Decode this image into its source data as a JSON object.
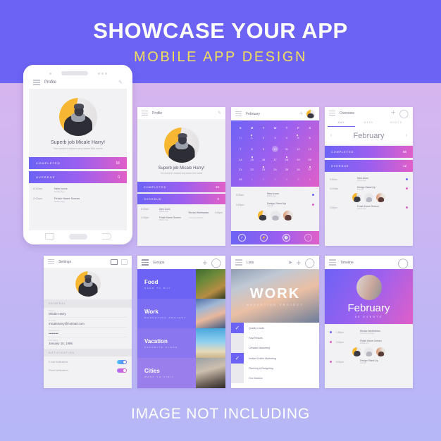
{
  "header": {
    "title": "SHOWCASE YOUR APP",
    "subtitle": "MOBILE APP DESIGN"
  },
  "footer": {
    "note": "IMAGE NOT INCLUDING"
  },
  "colors": {
    "brand_purple": "#6c63f5",
    "accent_yellow": "#f3e05a",
    "gradient_start": "#6c63f5",
    "gradient_mid": "#9a5ff0",
    "gradient_end": "#e05fc8",
    "bg_top": "#dcb3ec",
    "bg_bottom": "#b5b7f7",
    "screen_bg": "#f2f2f4"
  },
  "profile_screen": {
    "appbar": {
      "title": "Profile",
      "edit_icon": "pencil-icon",
      "menu_icon": "hamburger-icon"
    },
    "greeting": "Superb job Micale Harry!",
    "greeting_sub": "You haven't missed any tasks this week",
    "stats": [
      {
        "label": "COMPLETED",
        "value": "16"
      },
      {
        "label": "OVERDUE",
        "value": "0"
      }
    ],
    "tasks": [
      {
        "time": "8:30am",
        "name": "New Icons",
        "sub": "Mobile App"
      },
      {
        "time": "2:00pm",
        "name": "Finish Home Screen",
        "sub": "Mobile App"
      },
      {
        "time": "2:00pm",
        "name": "Revise Wireframes",
        "sub": "Company Website"
      }
    ]
  },
  "calendar_screen": {
    "appbar": {
      "title": "February",
      "dropdown_icon": "chevron-down-icon",
      "add_icon": "plus-icon",
      "avatar": "user-avatar"
    },
    "weekdays": [
      "S",
      "M",
      "T",
      "W",
      "T",
      "F",
      "S"
    ],
    "weeks": [
      [
        {
          "d": "31",
          "dim": true
        },
        {
          "d": "1",
          "mark": true
        },
        {
          "d": "2"
        },
        {
          "d": "3"
        },
        {
          "d": "4"
        },
        {
          "d": "5",
          "mark": true
        },
        {
          "d": "6"
        }
      ],
      [
        {
          "d": "7"
        },
        {
          "d": "8"
        },
        {
          "d": "9"
        },
        {
          "d": "10",
          "today": true
        },
        {
          "d": "11"
        },
        {
          "d": "12"
        },
        {
          "d": "13"
        }
      ],
      [
        {
          "d": "14"
        },
        {
          "d": "15",
          "mark": true
        },
        {
          "d": "16"
        },
        {
          "d": "17"
        },
        {
          "d": "18",
          "mark": true
        },
        {
          "d": "19"
        },
        {
          "d": "20"
        }
      ],
      [
        {
          "d": "21"
        },
        {
          "d": "22"
        },
        {
          "d": "23",
          "mark": true
        },
        {
          "d": "24"
        },
        {
          "d": "25"
        },
        {
          "d": "26"
        },
        {
          "d": "27",
          "mark": true
        }
      ],
      [
        {
          "d": "28"
        },
        {
          "d": "1",
          "dim": true
        },
        {
          "d": "2",
          "dim": true
        },
        {
          "d": "3",
          "dim": true
        },
        {
          "d": "4",
          "dim": true
        },
        {
          "d": "5",
          "dim": true
        },
        {
          "d": "6",
          "dim": true
        }
      ]
    ],
    "agenda": [
      {
        "time": "8:30am",
        "name": "New Icons",
        "sub": "Mobile App",
        "dot": "#6c63f5"
      },
      {
        "time": "5:00pm",
        "name": "Design Stand Up",
        "sub": "Internal",
        "dot": "#e05fc8"
      }
    ],
    "nav_icons": [
      "check-circle-icon",
      "flash-circle-icon",
      "clock-circle-icon",
      "info-circle-icon"
    ]
  },
  "overview_screen": {
    "appbar": {
      "title": "Overview",
      "add_icon": "plus-icon",
      "search_icon": "search-icon"
    },
    "tabs": [
      {
        "label": "DAY",
        "active": true
      },
      {
        "label": "WEEK",
        "active": false
      },
      {
        "label": "MONTH",
        "active": false
      }
    ],
    "month": "February",
    "prev_icon": "chevron-left-icon",
    "next_icon": "chevron-right-icon",
    "stats": [
      {
        "label": "COMPLETED",
        "value": "56"
      },
      {
        "label": "OVERDUE",
        "value": "12"
      }
    ],
    "agenda": [
      {
        "time": "8:30am",
        "name": "New Icons",
        "sub": "Mobile App",
        "dot": "#6c63f5"
      },
      {
        "time": "11:00am",
        "name": "Design Stand Up",
        "sub": "Internal",
        "dot": "#e05fc8"
      },
      {
        "time": "2:00pm",
        "name": "Finish Home Screen",
        "sub": "Mobile App",
        "dot": "#e05fc8"
      }
    ]
  },
  "settings_screen": {
    "appbar": {
      "title": "Settings",
      "image_icon": "image-icon",
      "save_icon": "save-icon"
    },
    "sections": [
      {
        "label": "GENERAL"
      },
      {
        "label": "NOTIFICATION"
      }
    ],
    "fields": [
      {
        "label": "Name",
        "value": "Micale Harry"
      },
      {
        "label": "E-mail",
        "value": "micaleharry@hotmail.com"
      },
      {
        "label": "Password",
        "value": "•••••••••"
      },
      {
        "label": "Birthday",
        "value": "January 15, 1996"
      }
    ],
    "toggles": [
      {
        "label": "E-mail Notifications",
        "on": true,
        "color": "blue"
      },
      {
        "label": "Phone Notifications",
        "on": true,
        "color": "pink"
      }
    ]
  },
  "groups_screen": {
    "appbar": {
      "title": "Groups",
      "add_icon": "plus-icon",
      "search_icon": "search-icon"
    },
    "groups": [
      {
        "title": "Food",
        "sub": "NEED TO BUY"
      },
      {
        "title": "Work",
        "sub": "MARKETING PROJECT"
      },
      {
        "title": "Vacation",
        "sub": "FAVORITE PLACE"
      },
      {
        "title": "Cities",
        "sub": "WANT TO VISIT"
      }
    ]
  },
  "lists_screen": {
    "appbar": {
      "title": "Lists",
      "share_icon": "share-icon",
      "add_icon": "plus-icon",
      "search_icon": "search-icon"
    },
    "hero_title": "WORK",
    "hero_sub": "MARKETING PROJECT",
    "items": [
      {
        "label": "Quality Leads",
        "checked": true
      },
      {
        "label": "Fast Results",
        "checked": false
      },
      {
        "label": "Creative Marketing",
        "checked": false
      },
      {
        "label": "Instant Online Marketing",
        "checked": true
      },
      {
        "label": "Planning & Budgeting",
        "checked": false
      },
      {
        "label": "Our Solution",
        "checked": false
      }
    ]
  },
  "timeline_screen": {
    "appbar": {
      "title": "Timeline",
      "search_icon": "search-icon"
    },
    "hero_month": "February",
    "hero_events": "69 EVENTS",
    "agenda": [
      {
        "time": "1:45pm",
        "name": "Revise Wireframes",
        "sub": "Company Website",
        "dot": "#6c63f5"
      },
      {
        "time": "2:00pm",
        "name": "Finish Home Screen",
        "sub": "Mobile App",
        "dot": "#e05fc8"
      },
      {
        "time": "5:00pm",
        "name": "Design Stand Up",
        "sub": "Internal",
        "dot": "#e05fc8"
      }
    ]
  }
}
